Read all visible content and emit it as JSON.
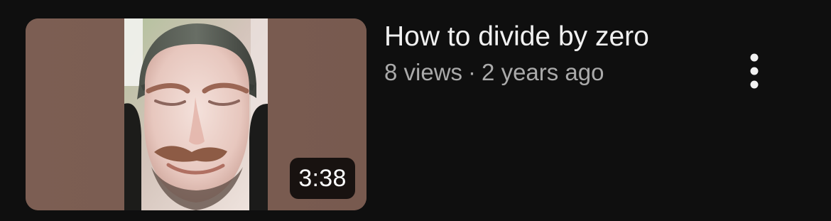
{
  "video": {
    "title": "How to divide by zero",
    "views": "8 views",
    "separator": "·",
    "age": "2 years ago",
    "duration": "3:38",
    "thumbnail_description": "Portrait video frame of a man wearing a dark beanie, centered against a brown letterbox background"
  },
  "actions": {
    "more_icon": "more-vertical-icon"
  },
  "colors": {
    "background": "#0f0f0f",
    "title_text": "#f1f1f1",
    "meta_text": "#aaaaaa",
    "thumbnail_letterbox": "#7a5b50",
    "duration_badge": "#000000"
  }
}
